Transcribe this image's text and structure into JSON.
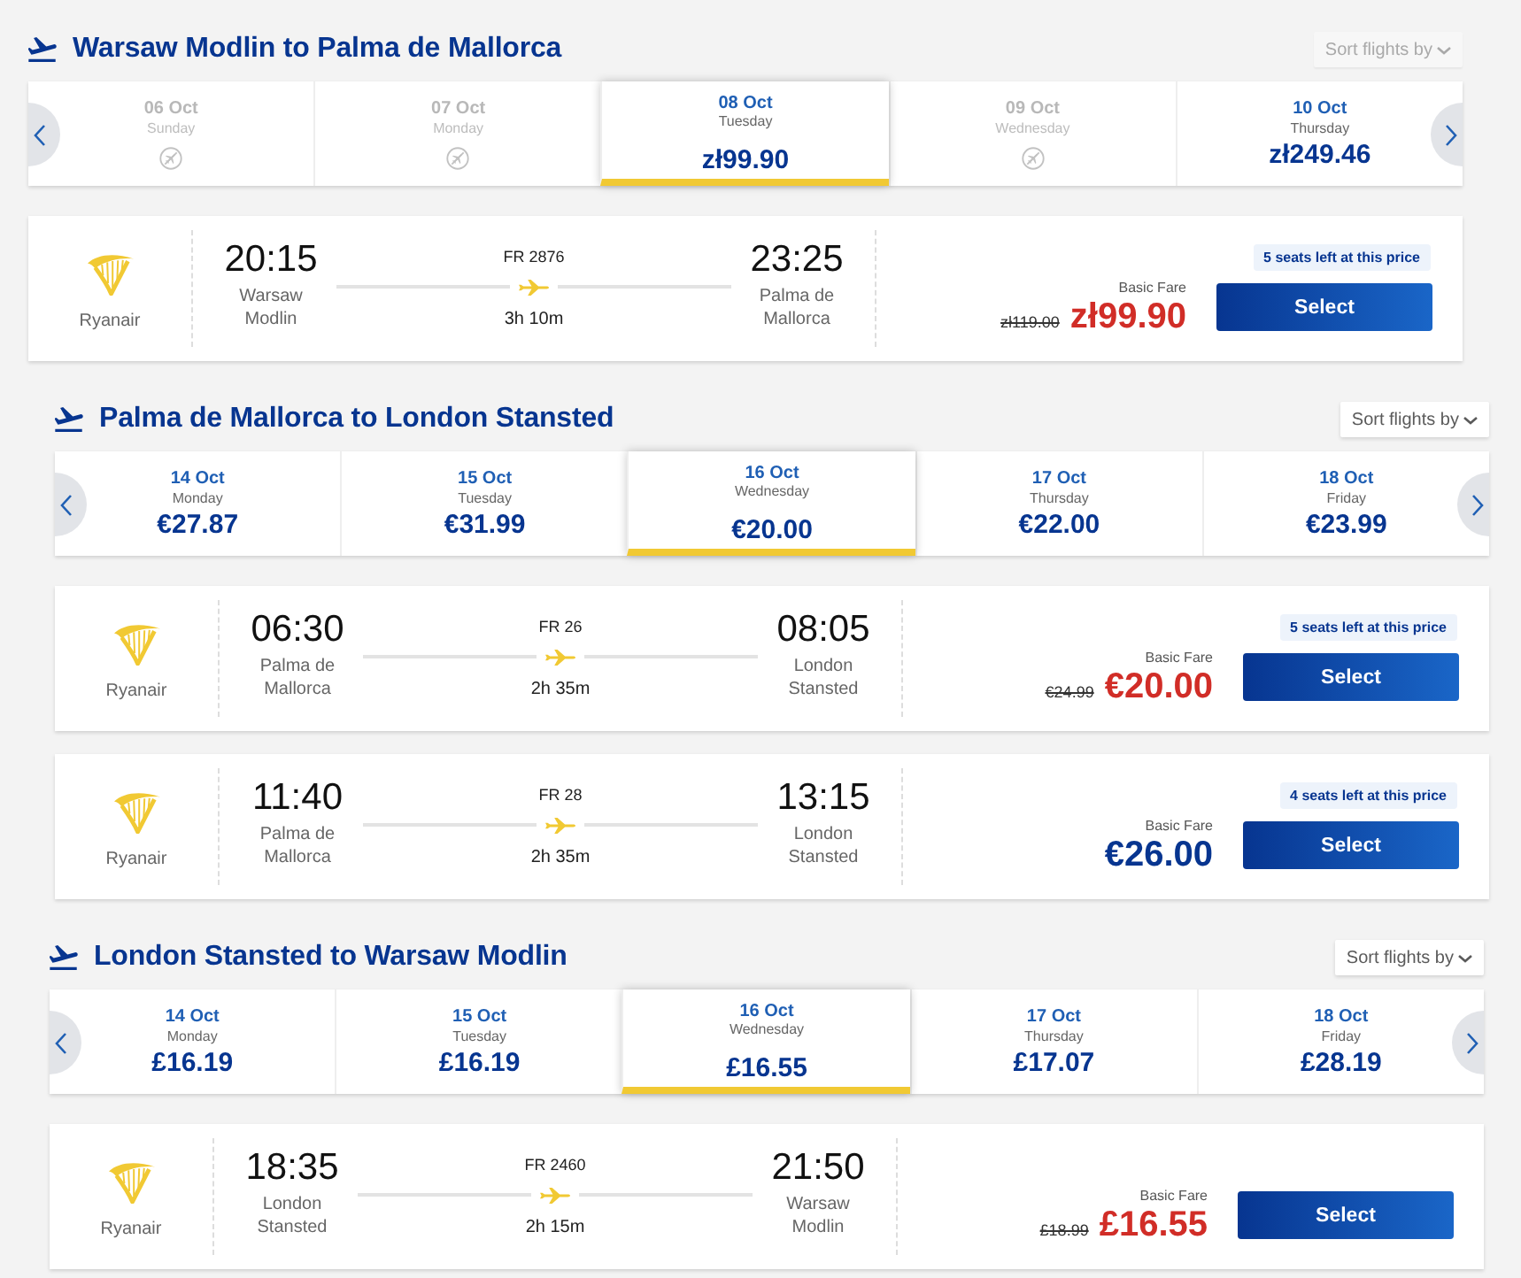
{
  "sections": [
    {
      "title": "Warsaw Modlin to Palma de Mallorca",
      "sort": {
        "label": "Sort flights by",
        "disabled": true
      },
      "dates": [
        {
          "date": "06 Oct",
          "day": "Sunday",
          "available": false,
          "selected": false
        },
        {
          "date": "07 Oct",
          "day": "Monday",
          "available": false,
          "selected": false
        },
        {
          "date": "08 Oct",
          "day": "Tuesday",
          "price": "zł99.90",
          "available": true,
          "selected": true
        },
        {
          "date": "09 Oct",
          "day": "Wednesday",
          "available": false,
          "selected": false
        },
        {
          "date": "10 Oct",
          "day": "Thursday",
          "price": "zł249.46",
          "available": true,
          "selected": false
        }
      ],
      "flights": [
        {
          "airline": "Ryanair",
          "departure": {
            "time": "20:15",
            "city": "Warsaw Modlin"
          },
          "flight_number": "FR 2876",
          "duration": "3h 10m",
          "arrival": {
            "time": "23:25",
            "city": "Palma de Mallorca"
          },
          "seats_left": "5 seats left at this price",
          "fare": "Basic Fare",
          "old_price": "zł119.00",
          "price": "zł99.90",
          "discounted": true,
          "button": "Select"
        }
      ]
    },
    {
      "title": "Palma de Mallorca to London Stansted",
      "sort": {
        "label": "Sort flights by",
        "disabled": false
      },
      "dates": [
        {
          "date": "14 Oct",
          "day": "Monday",
          "price": "€27.87",
          "available": true,
          "selected": false
        },
        {
          "date": "15 Oct",
          "day": "Tuesday",
          "price": "€31.99",
          "available": true,
          "selected": false
        },
        {
          "date": "16 Oct",
          "day": "Wednesday",
          "price": "€20.00",
          "available": true,
          "selected": true
        },
        {
          "date": "17 Oct",
          "day": "Thursday",
          "price": "€22.00",
          "available": true,
          "selected": false
        },
        {
          "date": "18 Oct",
          "day": "Friday",
          "price": "€23.99",
          "available": true,
          "selected": false
        }
      ],
      "flights": [
        {
          "airline": "Ryanair",
          "departure": {
            "time": "06:30",
            "city": "Palma de Mallorca"
          },
          "flight_number": "FR 26",
          "duration": "2h 35m",
          "arrival": {
            "time": "08:05",
            "city": "London Stansted"
          },
          "seats_left": "5 seats left at this price",
          "fare": "Basic Fare",
          "old_price": "€24.99",
          "price": "€20.00",
          "discounted": true,
          "button": "Select"
        },
        {
          "airline": "Ryanair",
          "departure": {
            "time": "11:40",
            "city": "Palma de Mallorca"
          },
          "flight_number": "FR 28",
          "duration": "2h 35m",
          "arrival": {
            "time": "13:15",
            "city": "London Stansted"
          },
          "seats_left": "4 seats left at this price",
          "fare": "Basic Fare",
          "price": "€26.00",
          "discounted": false,
          "button": "Select"
        }
      ]
    },
    {
      "title": "London Stansted to Warsaw Modlin",
      "sort": {
        "label": "Sort flights by",
        "disabled": false
      },
      "dates": [
        {
          "date": "14 Oct",
          "day": "Monday",
          "price": "£16.19",
          "available": true,
          "selected": false
        },
        {
          "date": "15 Oct",
          "day": "Tuesday",
          "price": "£16.19",
          "available": true,
          "selected": false
        },
        {
          "date": "16 Oct",
          "day": "Wednesday",
          "price": "£16.55",
          "available": true,
          "selected": true
        },
        {
          "date": "17 Oct",
          "day": "Thursday",
          "price": "£17.07",
          "available": true,
          "selected": false
        },
        {
          "date": "18 Oct",
          "day": "Friday",
          "price": "£28.19",
          "available": true,
          "selected": false
        }
      ],
      "flights": [
        {
          "airline": "Ryanair",
          "departure": {
            "time": "18:35",
            "city": "London Stansted"
          },
          "flight_number": "FR 2460",
          "duration": "2h 15m",
          "arrival": {
            "time": "21:50",
            "city": "Warsaw Modlin"
          },
          "fare": "Basic Fare",
          "old_price": "£18.99",
          "price": "£16.55",
          "discounted": true,
          "button": "Select"
        }
      ]
    }
  ]
}
